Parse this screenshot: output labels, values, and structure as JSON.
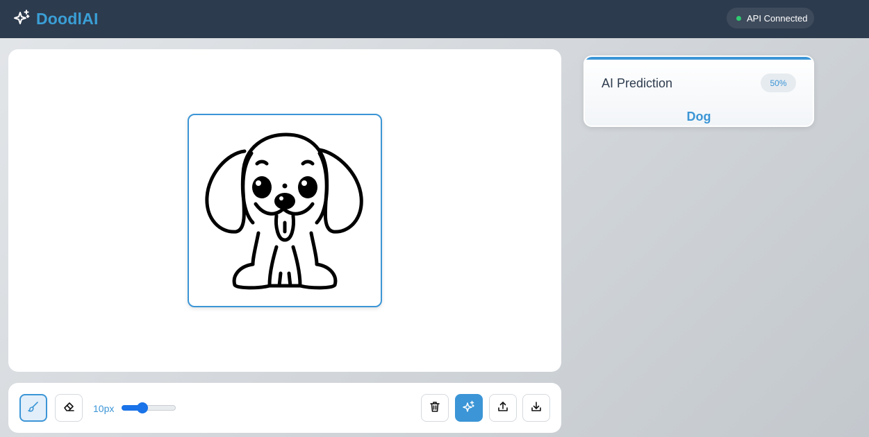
{
  "header": {
    "app_name": "DoodlAI",
    "logo_icon": "sparkles-icon",
    "status_text": "API Connected",
    "status_color": "#2ecc71"
  },
  "canvas": {
    "drawing_subject": "dog-doodle"
  },
  "toolbar": {
    "brush_icon": "brush-icon",
    "eraser_icon": "eraser-icon",
    "size_label": "10px",
    "size_slider_fraction": 0.35,
    "clear_icon": "trash-icon",
    "predict_icon": "sparkles-icon",
    "upload_icon": "upload-icon",
    "download_icon": "download-icon"
  },
  "prediction": {
    "title": "AI Prediction",
    "confidence": "50%",
    "label": "Dog"
  },
  "colors": {
    "accent": "#3b95d6",
    "header_bg": "#2d3b4e"
  }
}
